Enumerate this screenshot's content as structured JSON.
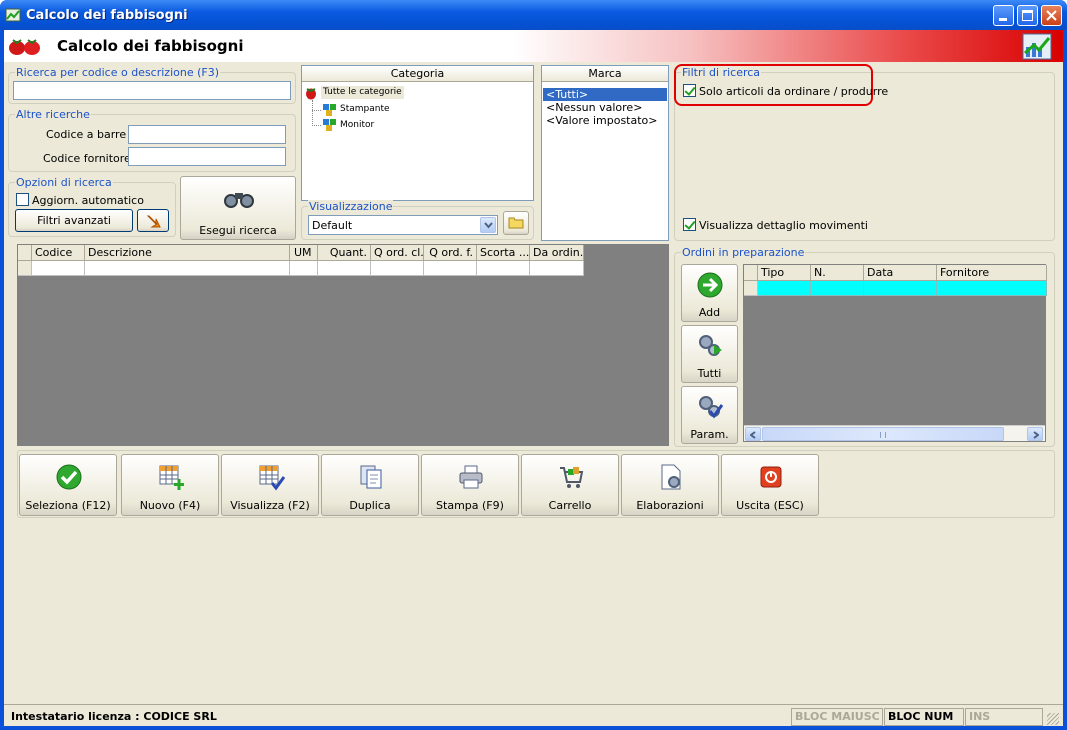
{
  "window": {
    "title": "Calcolo dei fabbisogni"
  },
  "header": {
    "title": "Calcolo dei fabbisogni"
  },
  "search": {
    "group_label": "Ricerca per codice o descrizione (F3)",
    "value": ""
  },
  "other_search": {
    "group_label": "Altre ricerche",
    "barcode_label": "Codice a barre :",
    "barcode_value": "",
    "supplier_code_label": "Codice fornitore :",
    "supplier_code_value": ""
  },
  "search_options": {
    "group_label": "Opzioni di ricerca",
    "auto_update_label": "Aggiorn. automatico",
    "auto_update_checked": false,
    "advanced_filters_label": "Filtri avanzati"
  },
  "run_search": {
    "label": "Esegui ricerca"
  },
  "categoria": {
    "header": "Categoria",
    "items": [
      "Tutte le categorie",
      "Stampante",
      "Monitor"
    ]
  },
  "visualizzazione": {
    "group_label": "Visualizzazione",
    "selected": "Default"
  },
  "marca": {
    "header": "Marca",
    "items": [
      "<Tutti>",
      "<Nessun valore>",
      "<Valore impostato>"
    ],
    "selected_index": 0
  },
  "filters": {
    "group_label": "Filtri di ricerca",
    "only_to_order_label": "Solo articoli da ordinare / produrre",
    "only_to_order_checked": true,
    "show_movements_label": "Visualizza dettaglio movimenti",
    "show_movements_checked": true
  },
  "articles_grid": {
    "columns": [
      "Codice",
      "Descrizione",
      "UM",
      "Quant.",
      "Q ord. cl.",
      "Q ord. f.",
      "Scorta ...",
      "Da ordin."
    ]
  },
  "orders": {
    "group_label": "Ordini in preparazione",
    "columns": [
      "Tipo",
      "N.",
      "Data",
      "Fornitore"
    ],
    "add_label": "Add",
    "all_label": "Tutti",
    "params_label": "Param."
  },
  "toolbar": {
    "select_label": "Seleziona (F12)",
    "new_label": "Nuovo (F4)",
    "view_label": "Visualizza (F2)",
    "duplicate_label": "Duplica",
    "print_label": "Stampa (F9)",
    "cart_label": "Carrello",
    "processing_label": "Elaborazioni",
    "exit_label": "Uscita (ESC)"
  },
  "status": {
    "license": "Intestatario licenza : CODICE SRL",
    "caps": "BLOC MAIUSC",
    "num": "BLOC NUM",
    "ins": "INS"
  },
  "colors": {
    "title_bar": "#0a5ae0",
    "highlight": "#316ac5",
    "selection_row": "#00ffff",
    "annotation": "#e00000"
  }
}
